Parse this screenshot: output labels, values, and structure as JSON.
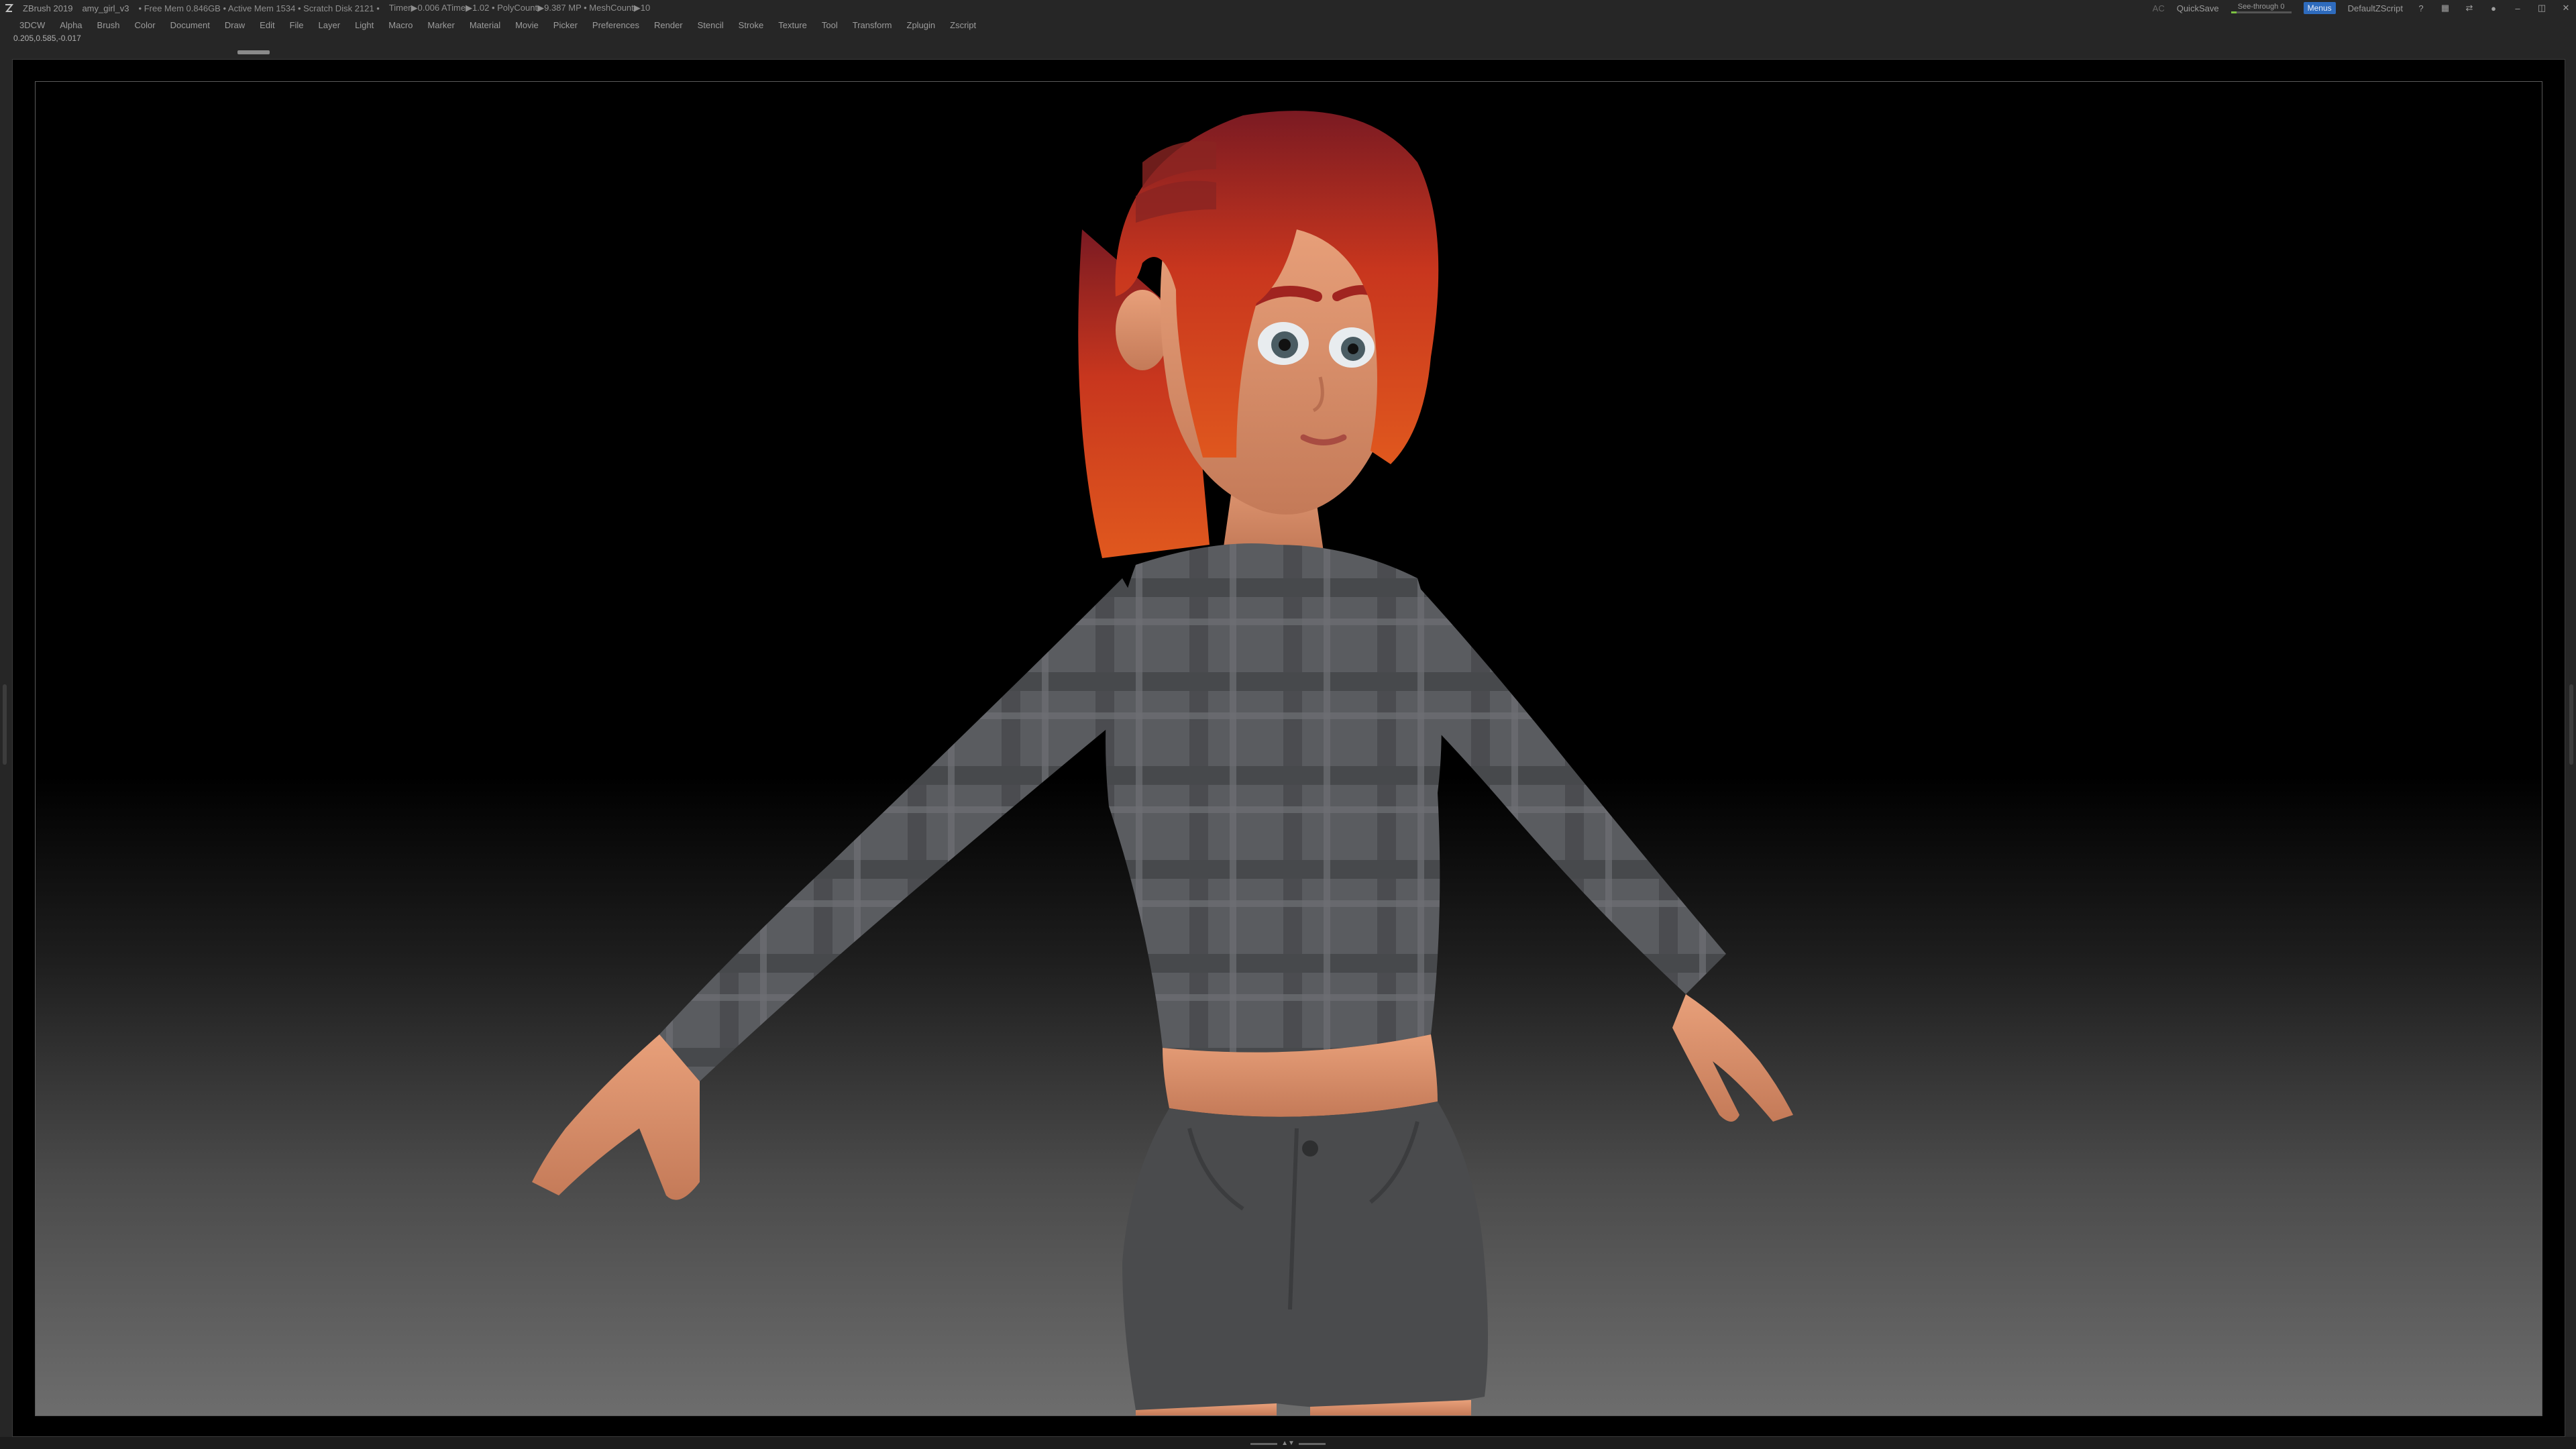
{
  "titlebar": {
    "app_title": "ZBrush 2019",
    "doc_name": "amy_girl_v3",
    "stats": [
      "• Free Mem 0.846GB • Active Mem 1534 • Scratch Disk 2121 •",
      "Timer▶0.006 ATime▶1.02 • PolyCount▶9.387 MP • MeshCount▶10"
    ],
    "ac_label": "AC",
    "quicksave_label": "QuickSave",
    "see_through_label": "See-through  0",
    "see_through_value": 0,
    "menus_label": "Menus",
    "default_zscript_label": "DefaultZScript"
  },
  "menubar": {
    "items": [
      "3DCW",
      "Alpha",
      "Brush",
      "Color",
      "Document",
      "Draw",
      "Edit",
      "File",
      "Layer",
      "Light",
      "Macro",
      "Marker",
      "Material",
      "Movie",
      "Picker",
      "Preferences",
      "Render",
      "Stencil",
      "Stroke",
      "Texture",
      "Tool",
      "Transform",
      "Zplugin",
      "Zscript"
    ]
  },
  "status": {
    "coords": "0.205,0.585,-0.017"
  },
  "colors": {
    "background": "#262626",
    "menus_button": "#2e6bbd",
    "see_through_fill": "#7dc142",
    "hair": "#c8361e",
    "skin": "#d88e6a",
    "shirt": "#5a5c60",
    "shorts": "#4a4b4d"
  },
  "icons": [
    "zbrush-logo-icon",
    "help-icon",
    "layout-icon",
    "swap-icon",
    "lock-icon",
    "minimize-icon",
    "maximize-icon",
    "close-icon"
  ]
}
